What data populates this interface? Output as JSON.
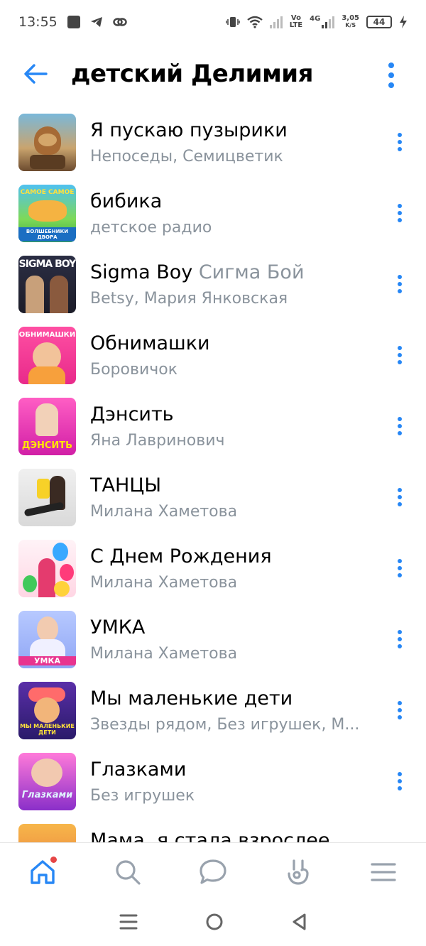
{
  "status_bar": {
    "time": "13:55",
    "volte_top": "Vo",
    "volte_bottom": "LTE",
    "network": "4G",
    "speed_value": "3,05",
    "speed_unit": "K/S",
    "battery": "44"
  },
  "header": {
    "title": "детский Делимия"
  },
  "tracks": [
    {
      "title": "Я пускаю пузырики",
      "title_sub": "",
      "artist": "Непоседы, Семицветик"
    },
    {
      "title": "бибика",
      "title_sub": "",
      "artist": "детское радио"
    },
    {
      "title": "Sigma Boy",
      "title_sub": "Сигма Бой",
      "artist": "Betsy, Мария Янковская"
    },
    {
      "title": "Обнимашки",
      "title_sub": "",
      "artist": "Боровичок"
    },
    {
      "title": "Дэнсить",
      "title_sub": "",
      "artist": "Яна Лавринович"
    },
    {
      "title": "ТАНЦЫ",
      "title_sub": "",
      "artist": "Милана Хаметова"
    },
    {
      "title": "С Днем Рождения",
      "title_sub": "",
      "artist": "Милана Хаметова"
    },
    {
      "title": "УМКА",
      "title_sub": "",
      "artist": "Милана Хаметова"
    },
    {
      "title": "Мы маленькие дети",
      "title_sub": "",
      "artist": "Звезды рядом, Без игрушек, М..."
    },
    {
      "title": "Глазками",
      "title_sub": "",
      "artist": "Без игрушек"
    },
    {
      "title": "Мама, я стала взрослее",
      "title_sub": "",
      "artist": ""
    }
  ],
  "covers": {
    "t0": "",
    "t1_top": "САМОЕ САМОЕ",
    "t1_bottom": "ВОЛШЕБНИКИ ДВОРА",
    "t2": "SIGMA BOY",
    "t3": "ОБНИМАШКИ",
    "t4": "ДЭНСИТЬ",
    "t7": "УМКА",
    "t8": "МЫ МАЛЕНЬКИЕ ДЕТИ",
    "t9": "Глазками"
  },
  "colors": {
    "accent": "#2787f5",
    "secondary_text": "#8a939c",
    "badge": "#e64646"
  },
  "nav": [
    "home-icon",
    "search-icon",
    "messages-icon",
    "clips-icon",
    "menu-icon"
  ]
}
